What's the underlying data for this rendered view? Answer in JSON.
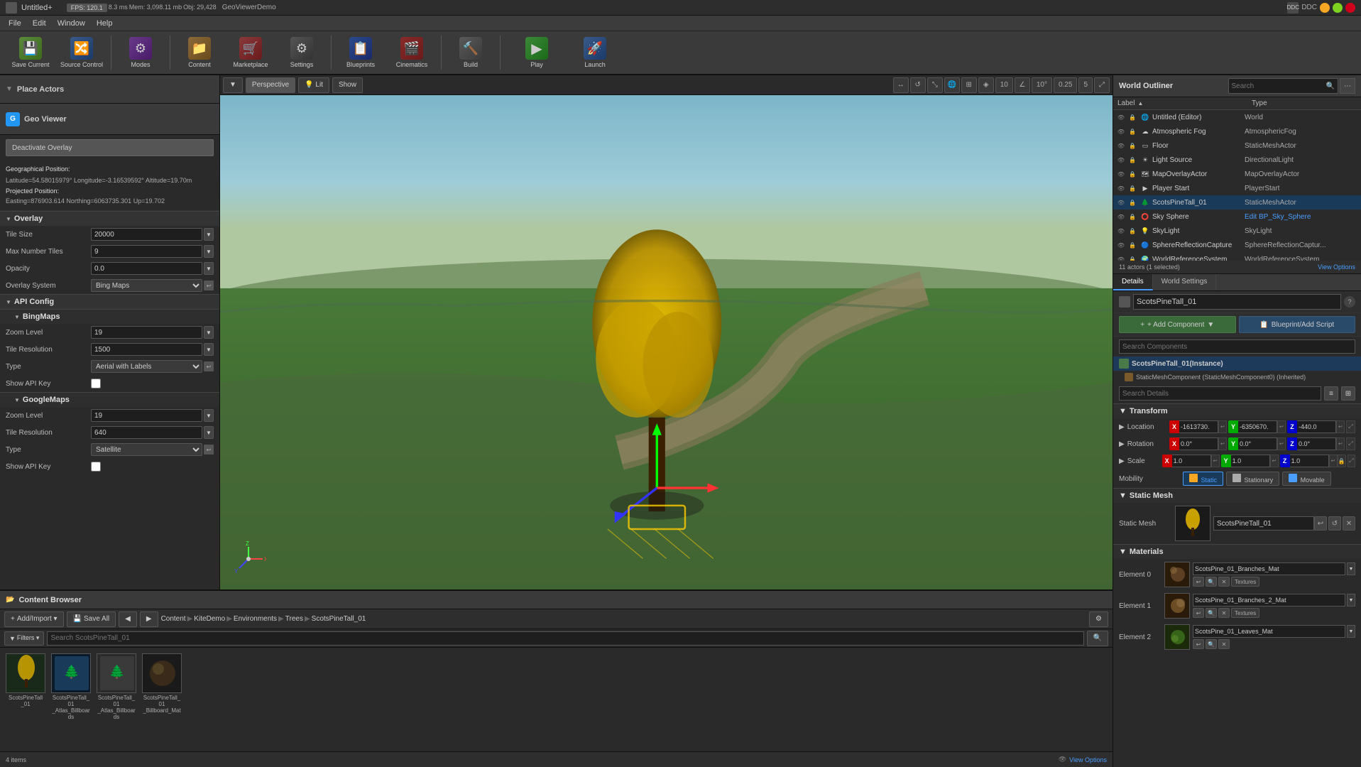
{
  "titlebar": {
    "title": "Untitled+",
    "app_name": "GeoViewerDemo",
    "fps": "FPS: 120.1",
    "ms": "8.3 ms",
    "mem": "Mem: 3,098.11 mb",
    "obj": "Obj: 29,428"
  },
  "menu": {
    "items": [
      "File",
      "Edit",
      "Window",
      "Help"
    ]
  },
  "toolbar": {
    "save_label": "Save Current",
    "source_control_label": "Source Control",
    "modes_label": "Modes",
    "content_label": "Content",
    "marketplace_label": "Marketplace",
    "settings_label": "Settings",
    "blueprints_label": "Blueprints",
    "cinematics_label": "Cinematics",
    "build_label": "Build",
    "play_label": "Play",
    "launch_label": "Launch"
  },
  "left_panel": {
    "place_actors_label": "Place Actors",
    "geo_viewer_label": "Geo Viewer",
    "deactivate_label": "Deactivate Overlay",
    "geo_info": {
      "lat": "Latitude=54.58015979°",
      "lon": "Longitude=-3.16539592°",
      "alt": "Altitude=19.70m",
      "easting": "Easting=876903.614",
      "northing": "Northing=6063735.301",
      "up": "Up=19.702"
    },
    "overlay": {
      "section_label": "Overlay",
      "tile_size_label": "Tile Size",
      "tile_size_value": "20000",
      "max_tiles_label": "Max Number Tiles",
      "max_tiles_value": "9",
      "opacity_label": "Opacity",
      "opacity_value": "0.0",
      "overlay_system_label": "Overlay System",
      "overlay_system_value": "Bing Maps"
    },
    "api_config": {
      "section_label": "API Config",
      "bing_maps_label": "BingMaps",
      "zoom_level_label": "Zoom Level",
      "zoom_level_value": "19",
      "tile_resolution_label": "Tile Resolution",
      "tile_resolution_value": "1500",
      "type_label": "Type",
      "type_value": "Aerial with Labels",
      "show_api_key_label": "Show API Key",
      "google_maps_label": "GoogleMaps",
      "gm_zoom_level_value": "19",
      "gm_tile_resolution_value": "640",
      "gm_type_value": "Satellite"
    }
  },
  "viewport": {
    "perspective_label": "Perspective",
    "lit_label": "Lit",
    "show_label": "Show"
  },
  "world_outliner": {
    "title": "World Outliner",
    "search_placeholder": "Search",
    "cols": [
      "Label",
      "Type"
    ],
    "actors": [
      {
        "name": "Untitled (Editor)",
        "type": "World",
        "icon": "🌐"
      },
      {
        "name": "Atmospheric Fog",
        "type": "AtmosphericFog",
        "icon": "☁"
      },
      {
        "name": "Floor",
        "type": "StaticMeshActor",
        "icon": "▭"
      },
      {
        "name": "Light Source",
        "type": "DirectionalLight",
        "icon": "☀"
      },
      {
        "name": "MapOverlayActor",
        "type": "MapOverlayActor",
        "icon": "🗺"
      },
      {
        "name": "Player Start",
        "type": "PlayerStart",
        "icon": "▶"
      },
      {
        "name": "ScotsPineTall_01",
        "type": "StaticMeshActor",
        "icon": "🌲",
        "selected": true
      },
      {
        "name": "Sky Sphere",
        "type": "Edit BP_Sky_Sphere",
        "icon": "⭕",
        "link": true
      },
      {
        "name": "SkyLight",
        "type": "SkyLight",
        "icon": "💡"
      },
      {
        "name": "SphereReflectionCapture",
        "type": "SphereReflectionCaptur...",
        "icon": "🔵"
      },
      {
        "name": "WorldReferenceSystem",
        "type": "WorldReferenceSystem",
        "icon": "🌍"
      }
    ],
    "actor_count": "11 actors (1 selected)",
    "view_options": "View Options"
  },
  "details": {
    "tabs": [
      "Details",
      "World Settings"
    ],
    "active_tab": "Details",
    "component_name": "ScotsPineTall_01",
    "add_component_label": "+ Add Component",
    "blueprint_label": "Blueprint/Add Script",
    "search_placeholder": "Search Components",
    "instance_label": "ScotsPineTall_01(Instance)",
    "static_mesh_component": "StaticMeshComponent (StaticMeshComponent0) (Inherited)",
    "search_details_placeholder": "Search Details",
    "transform": {
      "section_label": "Transform",
      "location_label": "Location",
      "location_x": "-1613730.",
      "location_y": "-6350670.",
      "location_z": "-440.0",
      "rotation_label": "Rotation",
      "rotation_x": "0.0°",
      "rotation_y": "0.0°",
      "rotation_z": "0.0°",
      "scale_label": "Scale",
      "scale_x": "1.0",
      "scale_y": "1.0",
      "scale_z": "1.0",
      "mobility_label": "Mobility",
      "mobility_static": "Static",
      "mobility_stationary": "Stationary",
      "mobility_movable": "Movable"
    },
    "static_mesh": {
      "section_label": "Static Mesh",
      "label": "Static Mesh",
      "mesh_name": "ScotsPineTall_01"
    },
    "materials": {
      "section_label": "Materials",
      "element0_label": "Element 0",
      "element0_name": "ScotsPine_01_Branches_Mat",
      "element0_tag": "Textures",
      "element1_label": "Element 1",
      "element1_name": "ScotsPine_01_Branches_2_Mat",
      "element1_tag": "Textures",
      "element2_label": "Element 2",
      "element2_name": "ScotsPine_01_Leaves_Mat"
    }
  },
  "content_browser": {
    "title": "Content Browser",
    "add_import_label": "Add/Import ▾",
    "save_all_label": "Save All",
    "path": [
      "Content",
      "KiteDemo",
      "Environments",
      "Trees",
      "ScotsPineTall_01"
    ],
    "filter_label": "Filters ▾",
    "search_placeholder": "Search ScotsPineTall_01",
    "items_count": "4 items",
    "view_options": "View Options",
    "assets": [
      {
        "name": "ScotsPineTall_01",
        "sub": "",
        "color": "#5a7a3a"
      },
      {
        "name": "ScotsPineTall_01_Atlas_Billboards",
        "sub": "",
        "color": "#3a5a7a"
      },
      {
        "name": "ScotsPineTall_01_Atlas_Billboards",
        "sub": "",
        "color": "#4a4a4a"
      },
      {
        "name": "ScotsPineTall_01_Billboard_Mat",
        "sub": "",
        "color": "#2a2a2a"
      }
    ]
  }
}
